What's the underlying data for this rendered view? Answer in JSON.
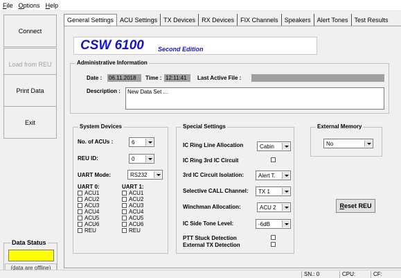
{
  "menu": {
    "items": [
      {
        "label": "File",
        "accel": "F"
      },
      {
        "label": "Options",
        "accel": "O"
      },
      {
        "label": "Help",
        "accel": "H"
      }
    ]
  },
  "sidebar": {
    "connect": "Connect",
    "load": "Load from REU",
    "print": "Print Data",
    "exit": "Exit",
    "data_status": {
      "title": "Data Status",
      "note": "(data are offline)",
      "color": "#ffff00"
    }
  },
  "tabs": [
    "General Settings",
    "ACU Settings",
    "TX Devices",
    "RX Devices",
    "FIX Channels",
    "Speakers",
    "Alert Tones",
    "Test Results"
  ],
  "header": {
    "product": "CSW 6100",
    "edition": "Second Edition"
  },
  "admin": {
    "title": "Administrative Information",
    "date_label": "Date :",
    "date_value": "06.11.2018",
    "time_label": "Time :",
    "time_value": "12:11:41",
    "last_file_label": "Last Active File :",
    "last_file_value": "",
    "desc_label": "Description :",
    "desc_value": "New Data Set ..."
  },
  "system": {
    "title": "System Devices",
    "num_acus_label": "No. of ACUs :",
    "num_acus_value": "6",
    "reu_id_label": "REU ID:",
    "reu_id_value": "0",
    "uart_mode_label": "UART Mode:",
    "uart_mode_value": "RS232",
    "uart0_label": "UART 0:",
    "uart1_label": "UART 1:",
    "uart0_items": [
      "ACU1",
      "ACU2",
      "ACU3",
      "ACU4",
      "ACU5",
      "ACU6",
      "REU"
    ],
    "uart1_items": [
      "ACU1",
      "ACU2",
      "ACU3",
      "ACU4",
      "ACU5",
      "ACU6",
      "REU"
    ]
  },
  "special": {
    "title": "Special Settings",
    "ring_line_label": "IC Ring Line Allocation",
    "ring_line_value": "Cabin",
    "ring_3rd_label": "IC Ring 3rd IC Circuit",
    "isolation_label": "3rd IC Circuit Isolation:",
    "isolation_value": "Alert T.",
    "selective_label": "Selective CALL Channel:",
    "selective_value": "TX 1",
    "winchman_label": "Winchman Allocation:",
    "winchman_value": "ACU 2",
    "sidetone_label": "IC Side Tone Level:",
    "sidetone_value": "-6dB",
    "ptt_label": "PTT Stuck Detection",
    "ext_tx_label": "External TX Detection"
  },
  "external_memory": {
    "title": "External Memory",
    "value": "No"
  },
  "reset_button": {
    "label": "Reset REU",
    "accel": "R"
  },
  "statusbar": {
    "sn": "SN.: 0",
    "cpu": "CPU:",
    "cf": "CF:"
  }
}
